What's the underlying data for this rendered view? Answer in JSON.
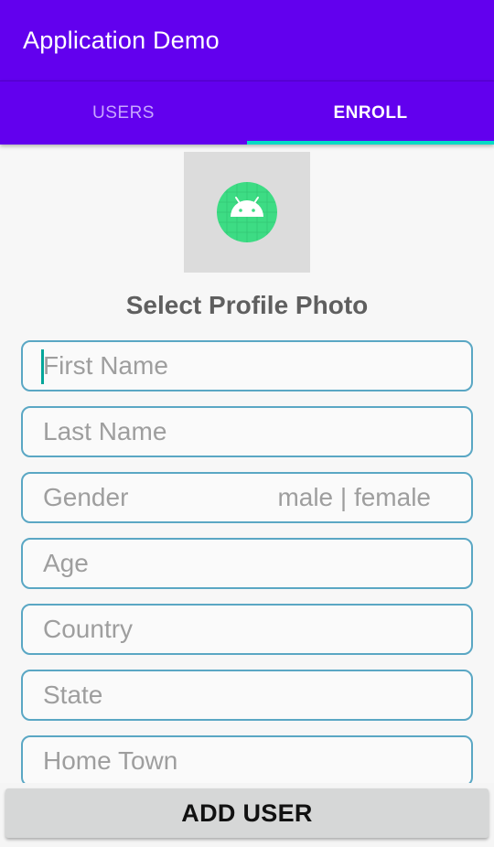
{
  "app_bar": {
    "title": "Application Demo",
    "color": "#6200ee"
  },
  "tabs": [
    {
      "label": "USERS",
      "active": false
    },
    {
      "label": "ENROLL",
      "active": true
    }
  ],
  "indicator_color": "#03dac5",
  "profile": {
    "photo_icon": "android-icon",
    "caption": "Select Profile Photo"
  },
  "form": {
    "first_name": {
      "placeholder": "First Name"
    },
    "last_name": {
      "placeholder": "Last Name"
    },
    "gender": {
      "placeholder": "Gender",
      "hint": "male | female"
    },
    "age": {
      "placeholder": "Age"
    },
    "country": {
      "placeholder": "Country"
    },
    "state": {
      "placeholder": "State"
    },
    "home_town": {
      "placeholder": "Home Town"
    }
  },
  "actions": {
    "add_user_label": "ADD USER"
  }
}
